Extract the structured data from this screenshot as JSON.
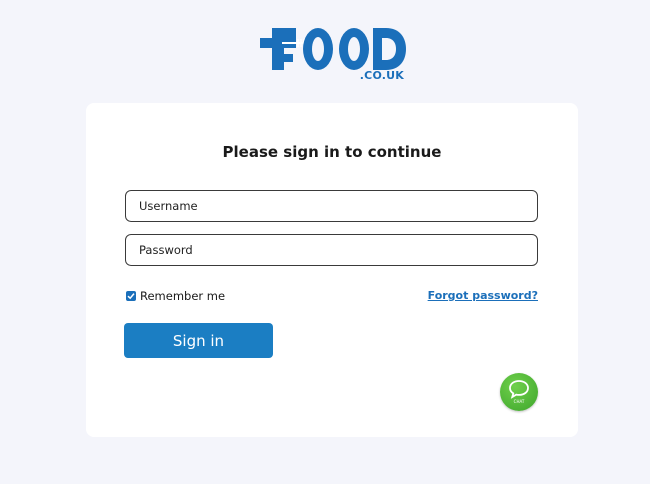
{
  "brand": {
    "name": "FOOD",
    "domain_suffix": ".CO.UK",
    "color": "#1b6fba"
  },
  "login": {
    "heading": "Please sign in to continue",
    "username_placeholder": "Username",
    "password_placeholder": "Password",
    "remember_label": "Remember me",
    "remember_checked": true,
    "forgot_label": "Forgot password?",
    "submit_label": "Sign in"
  },
  "chat_widget": {
    "icon": "chat-bubble-icon",
    "label": "CHAT",
    "color": "#4cb83a"
  },
  "colors": {
    "page_background": "#f4f5fb",
    "card_background": "#ffffff",
    "accent": "#1b7ec3"
  }
}
